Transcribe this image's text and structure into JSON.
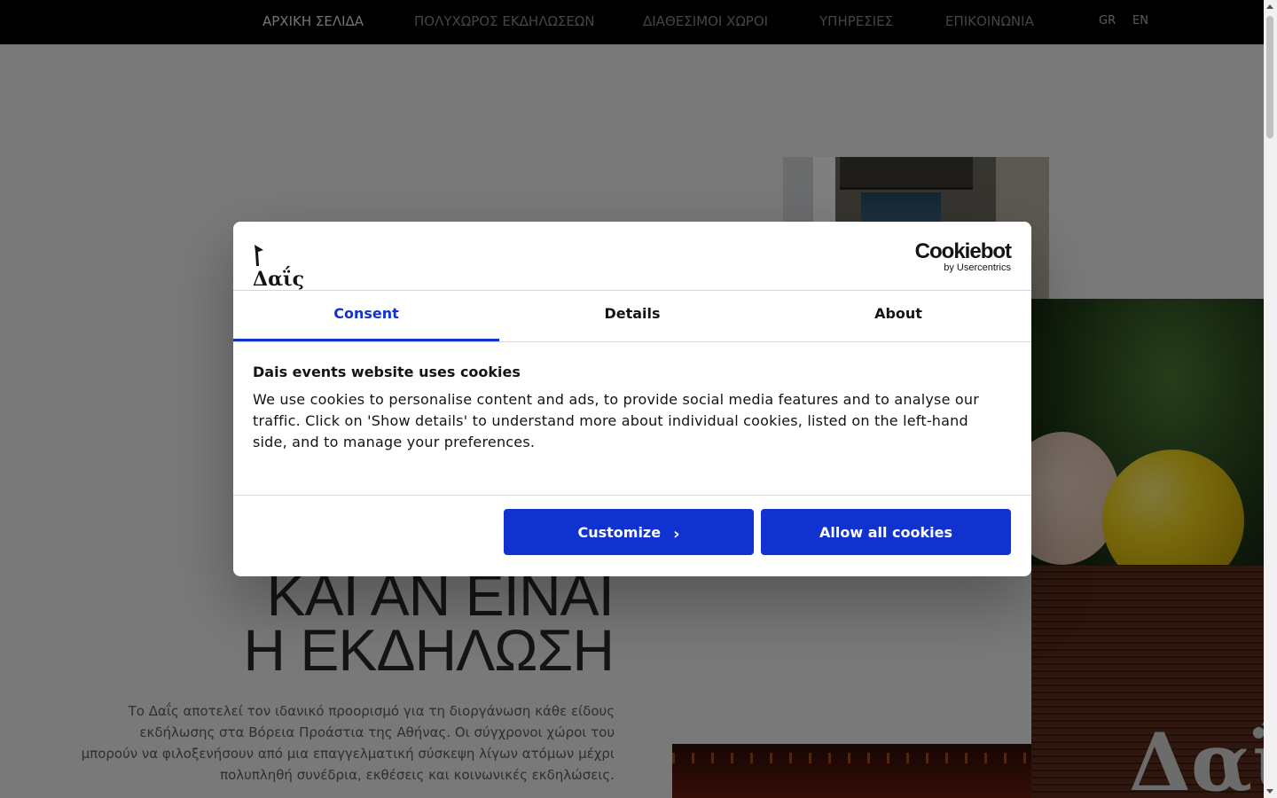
{
  "nav": {
    "items": [
      {
        "label": "ΑΡΧΙΚΗ ΣΕΛΙΔΑ",
        "active": true
      },
      {
        "label": "ΠΟΛΥΧΩΡΟΣ ΕΚΔΗΛΩΣΕΩΝ",
        "active": false
      },
      {
        "label": "ΔΙΑΘΕΣΙΜΟΙ ΧΩΡΟΙ",
        "active": false
      },
      {
        "label": "ΥΠΗΡΕΣΙΕΣ",
        "active": false
      },
      {
        "label": "ΕΠΙΚΟΙΝΩΝΙΑ",
        "active": false
      }
    ],
    "languages": [
      "GR",
      "EN"
    ]
  },
  "hero": {
    "headline_line1": "ΚΑΙ ΑΝ ΕΙΝΑΙ",
    "headline_line2": "Η ΕΚΔΗΛΩΣΗ",
    "intro": "Το Δαΐς αποτελεί τον ιδανικό προορισμό για τη διοργάνωση κάθε είδους εκδήλωσης στα Βόρεια Προάστια της Αθήνας. Οι σύγχρονοι χώροι του μπορούν να φιλοξενήσουν από μια επαγγελματική σύσκεψη λίγων ατόμων μέχρι πολυπληθή συνέδρια, εκθέσεις και κοινωνικές εκδηλώσεις."
  },
  "cookie_dialog": {
    "brand_name": "Δαΐς",
    "provider": "Cookiebot",
    "provider_sub": "by Usercentrics",
    "tabs": [
      {
        "label": "Consent",
        "active": true
      },
      {
        "label": "Details",
        "active": false
      },
      {
        "label": "About",
        "active": false
      }
    ],
    "title": "Dais events website uses cookies",
    "text": "We use cookies to personalise content and ads, to provide social media features and to analyse our traffic. Click on 'Show details' to understand more about individual cookies, listed on the left-hand side, and to manage your preferences.",
    "customize_label": "Customize",
    "allow_all_label": "Allow all cookies",
    "accent_color": "#1032cf"
  }
}
